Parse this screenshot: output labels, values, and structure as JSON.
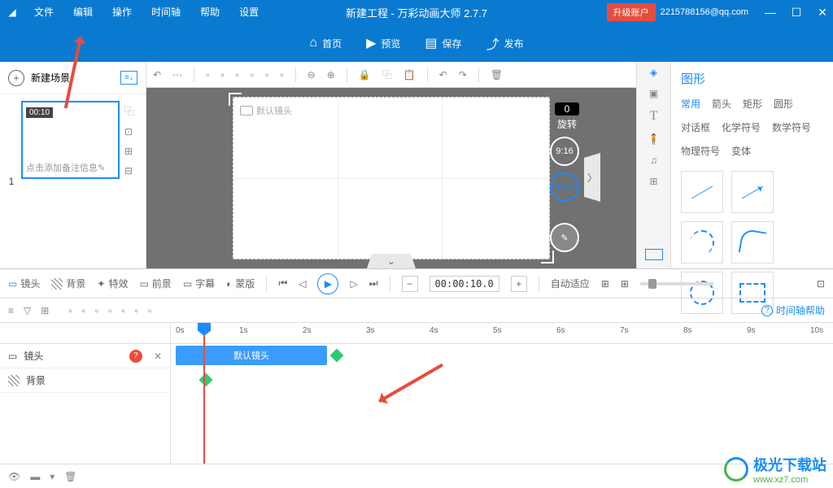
{
  "title": "新建工程 - 万彩动画大师 2.7.7",
  "menus": [
    "文件",
    "编辑",
    "操作",
    "时间轴",
    "帮助",
    "设置"
  ],
  "upgrade": "升级账户",
  "email": "2215788156@qq.com",
  "topbtns": [
    {
      "icon": "⌂",
      "label": "首页"
    },
    {
      "icon": "▣",
      "label": "预览"
    },
    {
      "icon": "💾",
      "label": "保存"
    },
    {
      "icon": "⤴",
      "label": "发布"
    }
  ],
  "newscene": "新建场景",
  "scene": {
    "num": "1",
    "dur": "00:10",
    "note": "点击添加备注信息✎"
  },
  "camlabel": "默认镜头",
  "rotation": {
    "val": "0",
    "label": "旋转"
  },
  "ratios": [
    "9:16",
    "16:9",
    "✎"
  ],
  "rpanel": {
    "title": "图形",
    "tabs": [
      "常用",
      "箭头",
      "矩形",
      "圆形",
      "对话框",
      "化学符号",
      "数学符号",
      "物理符号",
      "变体"
    ]
  },
  "tlbtns": [
    "镜头",
    "背景",
    "特效",
    "前景",
    "字幕",
    "蒙版"
  ],
  "timecode": "00:00:10.0",
  "autofit": "自动适应",
  "tlhelp": "时间轴帮助",
  "ticks": [
    "0s",
    "1s",
    "2s",
    "3s",
    "4s",
    "5s",
    "6s",
    "7s",
    "8s",
    "9s",
    "10s"
  ],
  "tracks": [
    {
      "icon": "cam",
      "label": "镜头",
      "q": true
    },
    {
      "icon": "hatch",
      "label": "背景"
    }
  ],
  "clip": "默认镜头",
  "watermark": {
    "t1": "极光下载站",
    "t2": "www.xz7.com"
  }
}
